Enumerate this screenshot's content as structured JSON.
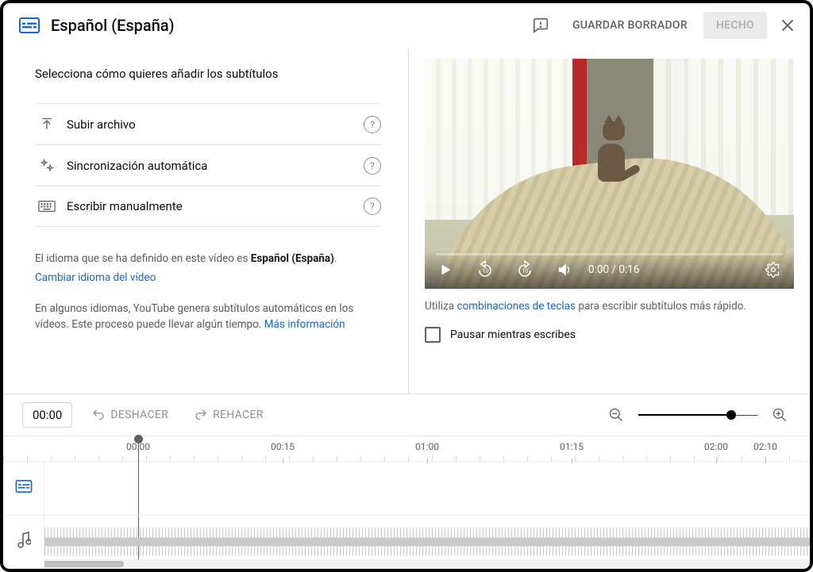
{
  "header": {
    "language_title": "Español (España)",
    "save_draft": "GUARDAR BORRADOR",
    "done": "HECHO"
  },
  "left": {
    "select_header": "Selecciona cómo quieres añadir los subtítulos",
    "methods": [
      {
        "label": "Subir archivo"
      },
      {
        "label": "Sincronización automática"
      },
      {
        "label": "Escribir manualmente"
      }
    ],
    "lang_info_prefix": "El idioma que se ha definido en este vídeo es ",
    "lang_info_bold": "Español (España)",
    "lang_info_suffix": ".",
    "change_lang": "Cambiar idioma del vídeo",
    "auto_info": "En algunos idiomas, YouTube genera subtítulos automáticos en los vídeos. Este proceso puede llevar algún tiempo. ",
    "more_info": "Más información"
  },
  "video": {
    "current": "0:00",
    "duration": "0:16",
    "separator": " / "
  },
  "hint": {
    "prefix": "Utiliza ",
    "link": "combinaciones de teclas",
    "suffix": " para escribir subtítulos más rápido."
  },
  "pause_while_typing": "Pausar mientras escribes",
  "toolbar": {
    "time": "00:00",
    "undo": "DESHACER",
    "redo": "REHACER"
  },
  "timeline": {
    "ticks": [
      "00:00",
      "00:15",
      "01:00",
      "01:15",
      "02:00",
      "02:10"
    ]
  }
}
